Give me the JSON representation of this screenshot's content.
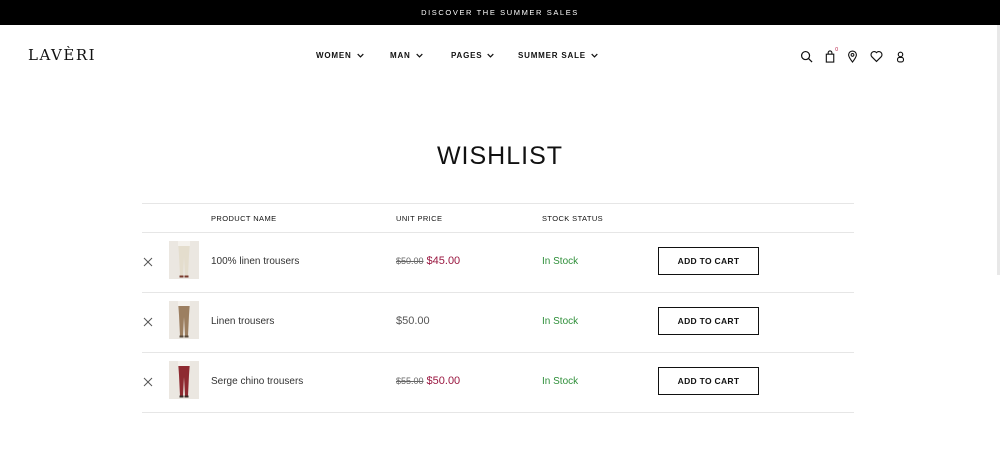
{
  "announcement": "DISCOVER THE SUMMER SALES",
  "logo": "LAVÈRI",
  "nav": [
    {
      "label": "WOMEN"
    },
    {
      "label": "MAN"
    },
    {
      "label": "PAGES"
    },
    {
      "label": "SUMMER SALE"
    }
  ],
  "header_icons": [
    "search-icon",
    "shopping-bag-icon",
    "location-pin-icon",
    "heart-icon",
    "user-icon"
  ],
  "cart_count": "0",
  "page_title": "WISHLIST",
  "table": {
    "headers": {
      "product_name": "PRODUCT NAME",
      "unit_price": "UNIT PRICE",
      "stock_status": "STOCK STATUS"
    },
    "rows": [
      {
        "name": "100% linen trousers",
        "old_price": "$50.00",
        "price": "$45.00",
        "stock": "In Stock",
        "button": "ADD TO CART",
        "pant_color": "#e4ddcd"
      },
      {
        "name": "Linen trousers",
        "old_price": "",
        "price": "$50.00",
        "stock": "In Stock",
        "button": "ADD TO CART",
        "pant_color": "#9c7f61"
      },
      {
        "name": "Serge chino trousers",
        "old_price": "$55.00",
        "price": "$50.00",
        "stock": "In Stock",
        "button": "ADD TO CART",
        "pant_color": "#8e2a31"
      }
    ]
  },
  "colors": {
    "sale_price": "#9a1740",
    "in_stock": "#2f8f3a",
    "topbar_bg": "#000000"
  }
}
